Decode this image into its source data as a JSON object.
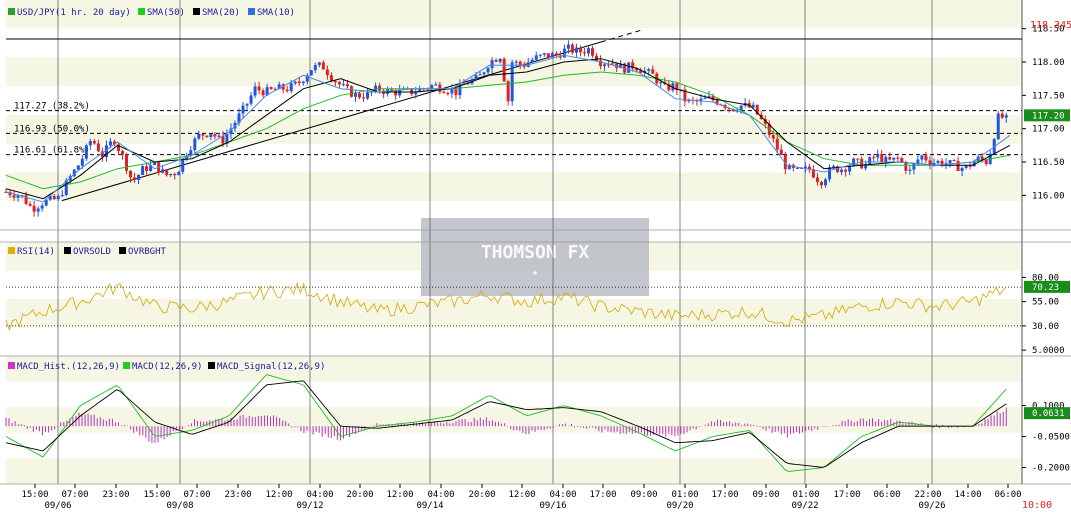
{
  "legend": {
    "price": [
      {
        "label": "USD/JPY(1 hr. 20 day)",
        "color": "#2ca02c"
      },
      {
        "label": "SMA(50)",
        "color": "#22cc22"
      },
      {
        "label": "SMA(20)",
        "color": "#000000"
      },
      {
        "label": "SMA(10)",
        "color": "#3070e0"
      }
    ],
    "rsi": [
      {
        "label": "RSI(14)",
        "color": "#e0b000"
      },
      {
        "label": "OVRSOLD",
        "color": "#000000"
      },
      {
        "label": "OVRBGHT",
        "color": "#000000"
      }
    ],
    "macd": [
      {
        "label": "MACD_Hist.(12,26,9)",
        "color": "#cc33cc"
      },
      {
        "label": "MACD(12,26,9)",
        "color": "#22cc22"
      },
      {
        "label": "MACD_Signal(12,26,9)",
        "color": "#000000"
      }
    ]
  },
  "watermark": "THOMSON FX",
  "colors": {
    "up": "#2255dd",
    "down": "#dd2222",
    "sma50": "#22bb22",
    "sma20": "#000000",
    "sma10": "#4a88e8",
    "rsi": "#d4a800",
    "hist": "#bb33bb"
  },
  "chart_data": [
    {
      "type": "candlestick",
      "ylim": [
        115.6,
        118.6
      ],
      "yticks": [
        "118.50",
        "118.00",
        "117.50",
        "117.00",
        "116.50",
        "116.00"
      ],
      "last_price_label": "117.20",
      "current_price_label": "118.345",
      "fib_levels": [
        {
          "label": "117.27 (38.2%)",
          "value": 117.27
        },
        {
          "label": "116.93 (50.0%)",
          "value": 116.93
        },
        {
          "label": "116.61 (61.8%)",
          "value": 116.61
        }
      ],
      "reference_line": 118.345,
      "trendline": {
        "from": [
          0.075,
          115.92
        ],
        "to": [
          0.8,
          118.3
        ]
      },
      "price_path": [
        [
          0.0,
          116.05
        ],
        [
          0.02,
          116.0
        ],
        [
          0.035,
          115.8
        ],
        [
          0.05,
          115.9
        ],
        [
          0.07,
          115.95
        ],
        [
          0.085,
          116.25
        ],
        [
          0.1,
          116.5
        ],
        [
          0.115,
          116.85
        ],
        [
          0.13,
          116.6
        ],
        [
          0.145,
          116.85
        ],
        [
          0.16,
          116.5
        ],
        [
          0.17,
          116.2
        ],
        [
          0.185,
          116.4
        ],
        [
          0.2,
          116.45
        ],
        [
          0.215,
          116.3
        ],
        [
          0.23,
          116.35
        ],
        [
          0.245,
          116.7
        ],
        [
          0.26,
          116.9
        ],
        [
          0.275,
          116.95
        ],
        [
          0.29,
          116.8
        ],
        [
          0.305,
          117.05
        ],
        [
          0.32,
          117.3
        ],
        [
          0.335,
          117.6
        ],
        [
          0.35,
          117.55
        ],
        [
          0.365,
          117.6
        ],
        [
          0.38,
          117.6
        ],
        [
          0.395,
          117.7
        ],
        [
          0.41,
          117.9
        ],
        [
          0.425,
          117.95
        ],
        [
          0.44,
          117.75
        ],
        [
          0.455,
          117.6
        ],
        [
          0.47,
          117.5
        ],
        [
          0.485,
          117.5
        ],
        [
          0.5,
          117.6
        ],
        [
          0.515,
          117.55
        ],
        [
          0.53,
          117.55
        ],
        [
          0.545,
          117.55
        ],
        [
          0.56,
          117.6
        ],
        [
          0.575,
          117.65
        ],
        [
          0.59,
          117.6
        ],
        [
          0.605,
          117.55
        ],
        [
          0.62,
          117.7
        ],
        [
          0.635,
          117.75
        ],
        [
          0.65,
          118.0
        ],
        [
          0.665,
          118.1
        ],
        [
          0.675,
          117.4
        ],
        [
          0.68,
          118.0
        ],
        [
          0.695,
          117.95
        ],
        [
          0.71,
          118.05
        ],
        [
          0.725,
          118.1
        ],
        [
          0.74,
          118.1
        ],
        [
          0.755,
          118.2
        ],
        [
          0.77,
          118.15
        ],
        [
          0.785,
          118.2
        ],
        [
          0.8,
          118.0
        ],
        [
          0.815,
          118.0
        ],
        [
          0.83,
          117.9
        ],
        [
          0.845,
          117.95
        ],
        [
          0.86,
          117.85
        ],
        [
          0.87,
          117.8
        ],
        [
          0.885,
          117.6
        ],
        [
          0.9,
          117.65
        ],
        [
          0.915,
          117.4
        ],
        [
          0.93,
          117.4
        ],
        [
          0.945,
          117.45
        ],
        [
          0.96,
          117.4
        ],
        [
          0.975,
          117.3
        ],
        [
          0.99,
          117.35
        ],
        [
          1.005,
          117.3
        ],
        [
          1.02,
          117.05
        ],
        [
          1.035,
          116.75
        ],
        [
          1.05,
          116.4
        ],
        [
          1.065,
          116.35
        ],
        [
          1.08,
          116.4
        ],
        [
          1.095,
          116.2
        ],
        [
          1.11,
          116.4
        ],
        [
          1.125,
          116.4
        ],
        [
          1.14,
          116.5
        ],
        [
          1.155,
          116.45
        ],
        [
          1.17,
          116.6
        ],
        [
          1.185,
          116.5
        ],
        [
          1.2,
          116.55
        ],
        [
          1.215,
          116.35
        ],
        [
          1.23,
          116.6
        ],
        [
          1.245,
          116.5
        ],
        [
          1.26,
          116.5
        ],
        [
          1.275,
          116.45
        ],
        [
          1.29,
          116.4
        ],
        [
          1.305,
          116.55
        ],
        [
          1.32,
          116.5
        ],
        [
          1.335,
          117.2
        ],
        [
          1.35,
          117.1
        ]
      ],
      "sma50_path": [
        [
          0.0,
          116.3
        ],
        [
          0.05,
          116.1
        ],
        [
          0.1,
          116.2
        ],
        [
          0.15,
          116.4
        ],
        [
          0.2,
          116.5
        ],
        [
          0.25,
          116.6
        ],
        [
          0.3,
          116.8
        ],
        [
          0.35,
          117.0
        ],
        [
          0.4,
          117.3
        ],
        [
          0.45,
          117.5
        ],
        [
          0.5,
          117.6
        ],
        [
          0.55,
          117.6
        ],
        [
          0.6,
          117.6
        ],
        [
          0.65,
          117.65
        ],
        [
          0.7,
          117.7
        ],
        [
          0.75,
          117.8
        ],
        [
          0.8,
          117.85
        ],
        [
          0.85,
          117.8
        ],
        [
          0.9,
          117.7
        ],
        [
          0.95,
          117.5
        ],
        [
          1.0,
          117.2
        ],
        [
          1.05,
          116.8
        ],
        [
          1.1,
          116.55
        ],
        [
          1.15,
          116.45
        ],
        [
          1.2,
          116.45
        ],
        [
          1.25,
          116.45
        ],
        [
          1.3,
          116.5
        ],
        [
          1.35,
          116.6
        ]
      ],
      "sma20_path": [
        [
          0.0,
          116.1
        ],
        [
          0.05,
          115.95
        ],
        [
          0.1,
          116.3
        ],
        [
          0.15,
          116.75
        ],
        [
          0.2,
          116.5
        ],
        [
          0.25,
          116.55
        ],
        [
          0.3,
          116.8
        ],
        [
          0.35,
          117.2
        ],
        [
          0.4,
          117.6
        ],
        [
          0.45,
          117.75
        ],
        [
          0.5,
          117.55
        ],
        [
          0.55,
          117.55
        ],
        [
          0.6,
          117.6
        ],
        [
          0.65,
          117.8
        ],
        [
          0.7,
          117.85
        ],
        [
          0.75,
          118.0
        ],
        [
          0.8,
          118.05
        ],
        [
          0.85,
          117.9
        ],
        [
          0.9,
          117.6
        ],
        [
          0.95,
          117.45
        ],
        [
          1.0,
          117.35
        ],
        [
          1.05,
          116.8
        ],
        [
          1.1,
          116.4
        ],
        [
          1.15,
          116.45
        ],
        [
          1.2,
          116.5
        ],
        [
          1.25,
          116.45
        ],
        [
          1.3,
          116.45
        ],
        [
          1.35,
          116.75
        ]
      ],
      "sma10_path": [
        [
          0.0,
          116.05
        ],
        [
          0.05,
          115.9
        ],
        [
          0.1,
          116.4
        ],
        [
          0.15,
          116.8
        ],
        [
          0.2,
          116.4
        ],
        [
          0.25,
          116.6
        ],
        [
          0.3,
          116.95
        ],
        [
          0.35,
          117.5
        ],
        [
          0.4,
          117.8
        ],
        [
          0.45,
          117.6
        ],
        [
          0.5,
          117.55
        ],
        [
          0.55,
          117.6
        ],
        [
          0.6,
          117.6
        ],
        [
          0.65,
          117.95
        ],
        [
          0.7,
          117.95
        ],
        [
          0.75,
          118.1
        ],
        [
          0.8,
          118.0
        ],
        [
          0.85,
          117.85
        ],
        [
          0.9,
          117.45
        ],
        [
          0.95,
          117.4
        ],
        [
          1.0,
          117.2
        ],
        [
          1.05,
          116.45
        ],
        [
          1.1,
          116.35
        ],
        [
          1.15,
          116.5
        ],
        [
          1.2,
          116.5
        ],
        [
          1.25,
          116.45
        ],
        [
          1.3,
          116.5
        ],
        [
          1.35,
          116.9
        ]
      ]
    },
    {
      "type": "line",
      "ylim": [
        0,
        100
      ],
      "yticks": [
        "80.00",
        "55.00",
        "30.00",
        "5.0000"
      ],
      "ytick_values": [
        80,
        55,
        30,
        5
      ],
      "overbought": 70,
      "oversold": 30,
      "last_value_label": "70.23",
      "rsi_path": [
        [
          0.0,
          30
        ],
        [
          0.05,
          45
        ],
        [
          0.1,
          55
        ],
        [
          0.15,
          70
        ],
        [
          0.2,
          50
        ],
        [
          0.25,
          48
        ],
        [
          0.3,
          55
        ],
        [
          0.35,
          65
        ],
        [
          0.4,
          68
        ],
        [
          0.45,
          55
        ],
        [
          0.5,
          45
        ],
        [
          0.55,
          50
        ],
        [
          0.6,
          55
        ],
        [
          0.65,
          62
        ],
        [
          0.7,
          55
        ],
        [
          0.75,
          60
        ],
        [
          0.8,
          50
        ],
        [
          0.85,
          45
        ],
        [
          0.9,
          40
        ],
        [
          0.95,
          42
        ],
        [
          1.0,
          45
        ],
        [
          1.05,
          35
        ],
        [
          1.1,
          40
        ],
        [
          1.15,
          50
        ],
        [
          1.2,
          55
        ],
        [
          1.25,
          50
        ],
        [
          1.3,
          55
        ],
        [
          1.35,
          70
        ]
      ]
    },
    {
      "type": "line",
      "ylim": [
        -0.27,
        0.33
      ],
      "yticks": [
        "0.1000",
        "-0.0500",
        "-0.2000"
      ],
      "ytick_values": [
        0.1,
        -0.05,
        -0.2
      ],
      "last_value_label": "0.0631",
      "macd_path": [
        [
          0.0,
          -0.05
        ],
        [
          0.05,
          -0.15
        ],
        [
          0.1,
          0.1
        ],
        [
          0.15,
          0.2
        ],
        [
          0.2,
          -0.05
        ],
        [
          0.25,
          -0.02
        ],
        [
          0.3,
          0.05
        ],
        [
          0.35,
          0.25
        ],
        [
          0.4,
          0.2
        ],
        [
          0.45,
          -0.05
        ],
        [
          0.5,
          0.0
        ],
        [
          0.55,
          0.02
        ],
        [
          0.6,
          0.05
        ],
        [
          0.65,
          0.15
        ],
        [
          0.7,
          0.05
        ],
        [
          0.75,
          0.1
        ],
        [
          0.8,
          0.05
        ],
        [
          0.85,
          -0.03
        ],
        [
          0.9,
          -0.12
        ],
        [
          0.95,
          -0.05
        ],
        [
          1.0,
          -0.02
        ],
        [
          1.05,
          -0.22
        ],
        [
          1.1,
          -0.2
        ],
        [
          1.15,
          -0.05
        ],
        [
          1.2,
          0.02
        ],
        [
          1.25,
          0.0
        ],
        [
          1.3,
          0.0
        ],
        [
          1.35,
          0.2
        ]
      ],
      "signal_path": [
        [
          0.0,
          -0.08
        ],
        [
          0.05,
          -0.12
        ],
        [
          0.1,
          0.05
        ],
        [
          0.15,
          0.18
        ],
        [
          0.2,
          0.02
        ],
        [
          0.25,
          -0.04
        ],
        [
          0.3,
          0.02
        ],
        [
          0.35,
          0.2
        ],
        [
          0.4,
          0.22
        ],
        [
          0.45,
          0.0
        ],
        [
          0.5,
          -0.01
        ],
        [
          0.55,
          0.01
        ],
        [
          0.6,
          0.03
        ],
        [
          0.65,
          0.12
        ],
        [
          0.7,
          0.08
        ],
        [
          0.75,
          0.09
        ],
        [
          0.8,
          0.07
        ],
        [
          0.85,
          0.0
        ],
        [
          0.9,
          -0.08
        ],
        [
          0.95,
          -0.07
        ],
        [
          1.0,
          -0.03
        ],
        [
          1.05,
          -0.18
        ],
        [
          1.1,
          -0.2
        ],
        [
          1.15,
          -0.08
        ],
        [
          1.2,
          0.0
        ],
        [
          1.25,
          0.0
        ],
        [
          1.3,
          0.0
        ],
        [
          1.35,
          0.12
        ]
      ]
    }
  ],
  "xaxis": {
    "time_labels": [
      "15:00",
      "07:00",
      "23:00",
      "15:00",
      "07:00",
      "23:00",
      "12:00",
      "04:00",
      "20:00",
      "12:00",
      "04:00",
      "20:00",
      "12:00",
      "04:00",
      "17:00",
      "09:00",
      "01:00",
      "17:00",
      "09:00",
      "01:00",
      "17:00",
      "06:00",
      "22:00",
      "14:00",
      "06:00"
    ],
    "date_labels": [
      "09/06",
      "09/08",
      "09/12",
      "09/14",
      "09/16",
      "09/20",
      "09/22",
      "09/26"
    ],
    "current_time_label": "10:00"
  }
}
